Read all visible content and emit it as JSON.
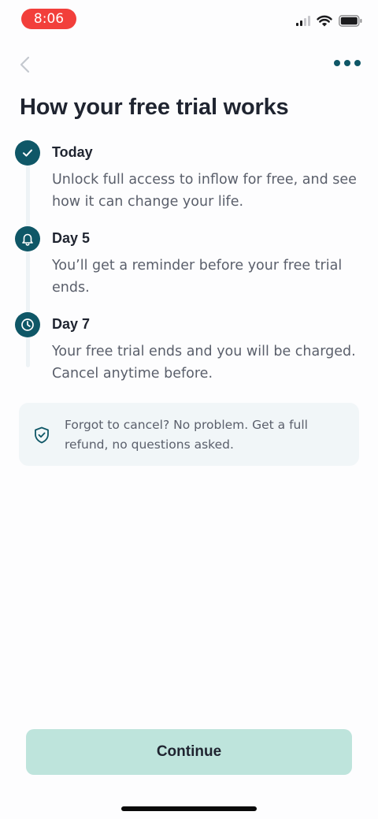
{
  "status_bar": {
    "time": "8:06",
    "icons": [
      "signal-icon",
      "wifi-icon",
      "battery-icon"
    ]
  },
  "nav": {
    "back_icon": "chevron-left-icon",
    "more_icon": "more-dots-icon"
  },
  "title": "How your free trial works",
  "steps": [
    {
      "title": "Today",
      "description": "Unlock full access to inflow for free, and see how it can change your life.",
      "icon": "check-icon"
    },
    {
      "title": "Day 5",
      "description": "You’ll get a reminder before your free trial ends.",
      "icon": "bell-icon"
    },
    {
      "title": "Day 7",
      "description": "Your free trial ends and you will be charged. Cancel anytime before.",
      "icon": "clock-icon"
    }
  ],
  "info_card": {
    "icon": "shield-check-icon",
    "text": "Forgot to cancel? No problem. Get a full refund, no questions asked."
  },
  "continue_label": "Continue",
  "colors": {
    "accent": "#0f5767",
    "time_pill": "#f23f3b",
    "button_bg": "#bee4dc",
    "card_bg": "#f1f6f8"
  }
}
